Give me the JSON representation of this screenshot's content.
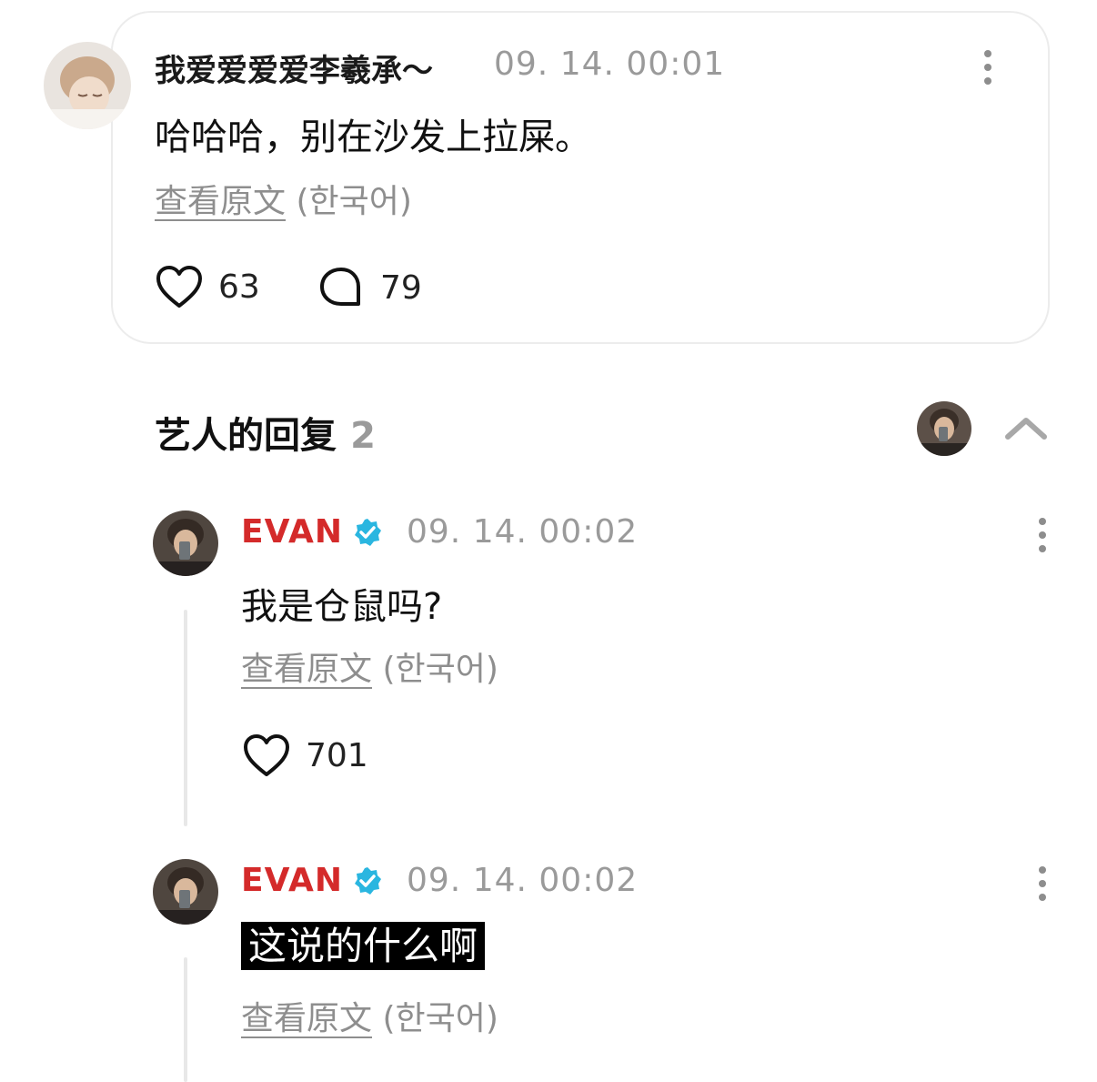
{
  "comment": {
    "username": "我爱爱爱爱李羲承～",
    "timestamp": "09. 14. 00:01",
    "text": "哈哈哈，别在沙发上拉屎。",
    "view_original": "查看原文",
    "language": "(한국어)",
    "likes": "63",
    "replies": "79"
  },
  "artist_replies": {
    "title": "艺人的回复",
    "count": "2"
  },
  "replies": [
    {
      "author": "EVAN",
      "timestamp": "09. 14. 00:02",
      "text": "我是仓鼠吗?",
      "view_original": "查看原文",
      "language": "(한국어)",
      "likes": "701"
    },
    {
      "author": "EVAN",
      "timestamp": "09. 14. 00:02",
      "text": "这说的什么啊",
      "view_original": "查看原文",
      "language": "(한국어)"
    }
  ],
  "colors": {
    "artist_name": "#d42a2a",
    "verified_badge": "#2ab6e0",
    "muted": "#9a9a9a"
  },
  "icons": [
    "heart-icon",
    "comment-bubble-icon",
    "verified-badge-icon",
    "more-options-icon",
    "chevron-up-icon"
  ]
}
